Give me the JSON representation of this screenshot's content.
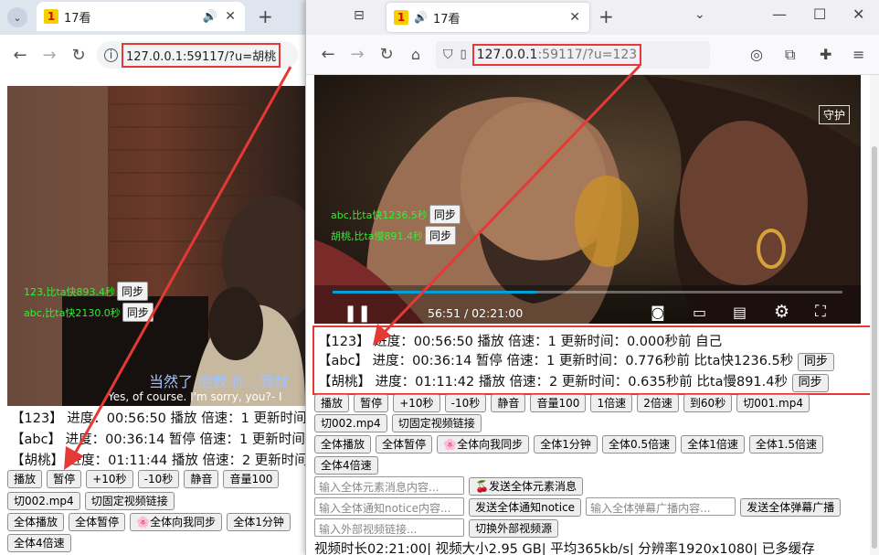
{
  "left": {
    "tab_title": "17看",
    "favicon": "1",
    "url": "127.0.0.1:59117/?u=胡桃",
    "subtitle_cn": "当然了 抱歉 你...我就",
    "subtitle_en": "Yes, of course. I'm sorry, you?- I",
    "labels": [
      {
        "text": "123,比ta快893.4秒",
        "btn": "同步"
      },
      {
        "text": "abc,比ta快2130.0秒",
        "btn": "同步"
      }
    ],
    "status": [
      "【123】 进度：00:56:50 播放 倍速：1 更新时间",
      "【abc】 进度：00:36:14 暂停 倍速：1 更新时间",
      "【胡桃】 进度：01:11:44 播放 倍速：2 更新时间"
    ],
    "row1": [
      "播放",
      "暂停",
      "+10秒",
      "-10秒",
      "静音",
      "音量100"
    ],
    "row2": [
      "切002.mp4",
      "切固定视频链接"
    ],
    "row3": [
      "全体播放",
      "全体暂停",
      "🌸全体向我同步",
      "全体1分钟"
    ],
    "row4": [
      "全体4倍速"
    ]
  },
  "right": {
    "tab_title": "17看",
    "favicon": "1",
    "url_main": "127.0.0.1",
    "url_rest": ":59117/?u=123",
    "guard_label": "守护",
    "labels": [
      {
        "text": "abc,比ta快1236.5秒",
        "btn": "同步"
      },
      {
        "text": "胡桃,比ta慢891.4秒",
        "btn": "同步"
      }
    ],
    "time_display": "56:51 / 02:21:00",
    "progress": 0.402,
    "status": [
      {
        "text": "【123】 进度：00:56:50 播放 倍速：1 更新时间：0.000秒前 自己",
        "btn": ""
      },
      {
        "text": "【abc】 进度：00:36:14 暂停 倍速：1 更新时间：0.776秒前 比ta快1236.5秒",
        "btn": "同步"
      },
      {
        "text": "【胡桃】 进度：01:11:42 播放 倍速：2 更新时间：0.635秒前 比ta慢891.4秒",
        "btn": "同步"
      }
    ],
    "row1": [
      "播放",
      "暂停",
      "+10秒",
      "-10秒",
      "静音",
      "音量100",
      "1倍速",
      "2倍速",
      "到60秒",
      "切001.mp4"
    ],
    "row2": [
      "切002.mp4",
      "切固定视频链接"
    ],
    "row3": [
      "全体播放",
      "全体暂停",
      "🌸全体向我同步",
      "全体1分钟",
      "全体0.5倍速",
      "全体1倍速",
      "全体1.5倍速"
    ],
    "row4": [
      "全体4倍速"
    ],
    "elem_placeholder": "输入全体元素消息内容...",
    "elem_send": "🍒发送全体元素消息",
    "notice_placeholder": "输入全体通知notice内容...",
    "notice_send": "发送全体通知notice",
    "danmu_placeholder": "输入全体弹幕广播内容...",
    "danmu_send": "发送全体弹幕广播",
    "ext_placeholder": "输入外部视频链接...",
    "ext_send": "切换外部视频源",
    "info": "视频时长02:21:00| 视频大小2.95 GB| 平均365kb/s| 分辨率1920x1080| 已多缓存"
  }
}
